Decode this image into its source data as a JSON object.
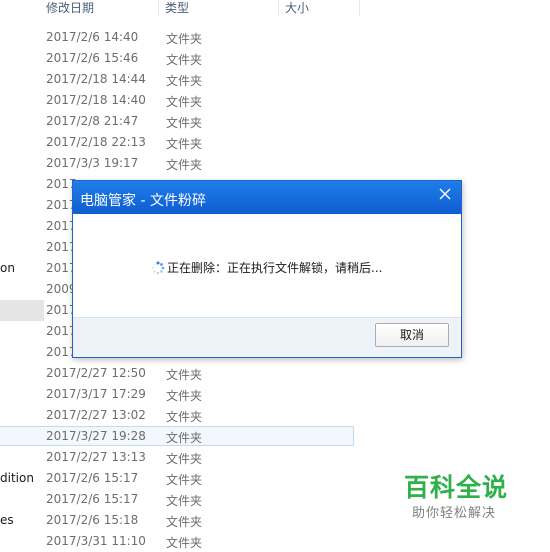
{
  "columns": {
    "date": "修改日期",
    "type": "类型",
    "size": "大小"
  },
  "rows": [
    {
      "left": "",
      "date": "2017/2/6 14:40",
      "type": "文件夹"
    },
    {
      "left": "",
      "date": "2017/2/6 15:46",
      "type": "文件夹"
    },
    {
      "left": "",
      "date": "2017/2/18 14:44",
      "type": "文件夹"
    },
    {
      "left": "",
      "date": "2017/2/18 14:40",
      "type": "文件夹"
    },
    {
      "left": "",
      "date": "2017/2/8 21:47",
      "type": "文件夹"
    },
    {
      "left": "",
      "date": "2017/2/18 22:13",
      "type": "文件夹"
    },
    {
      "left": "",
      "date": "2017/3/3 19:17",
      "type": "文件夹"
    },
    {
      "left": "",
      "date": "2017",
      "type": ""
    },
    {
      "left": "",
      "date": "2017",
      "type": ""
    },
    {
      "left": "",
      "date": "2017",
      "type": ""
    },
    {
      "left": "",
      "date": "2017",
      "type": ""
    },
    {
      "left": "on",
      "date": "2017",
      "type": ""
    },
    {
      "left": "",
      "date": "2009",
      "type": ""
    },
    {
      "left": "",
      "date": "2017",
      "type": ""
    },
    {
      "left": "",
      "date": "2017",
      "type": ""
    },
    {
      "left": "",
      "date": "2017",
      "type": ""
    },
    {
      "left": "",
      "date": "2017/2/27 12:50",
      "type": "文件夹"
    },
    {
      "left": "",
      "date": "2017/3/17 17:29",
      "type": "文件夹"
    },
    {
      "left": "",
      "date": "2017/2/27 13:02",
      "type": "文件夹"
    },
    {
      "left": "",
      "date": "2017/3/27 19:28",
      "type": "文件夹"
    },
    {
      "left": "",
      "date": "2017/2/27 13:13",
      "type": "文件夹"
    },
    {
      "left": "dition",
      "date": "2017/2/6 15:17",
      "type": "文件夹"
    },
    {
      "left": "",
      "date": "2017/2/6 15:17",
      "type": "文件夹"
    },
    {
      "left": "es",
      "date": "2017/2/6 15:18",
      "type": "文件夹"
    },
    {
      "left": "",
      "date": "2017/3/31 11:10",
      "type": "文件夹"
    }
  ],
  "dialog": {
    "title": "电脑管家 - 文件粉碎",
    "status": "正在删除：正在执行文件解锁，请稍后...",
    "cancel_label": "取消"
  },
  "watermark": {
    "title": "百科全说",
    "subtitle": "助你轻松解决"
  },
  "colors": {
    "title_bar": "#1f7ee8",
    "watermark_green": "#2fb049",
    "selection_border": "#bcdcf4"
  }
}
